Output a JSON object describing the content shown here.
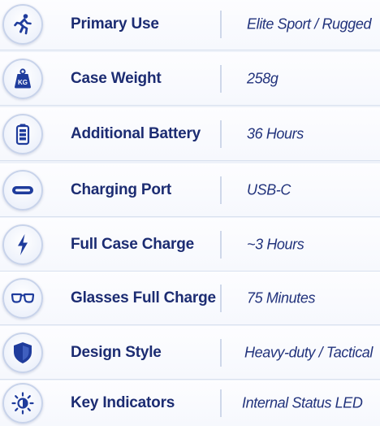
{
  "colors": {
    "accent": "#1c2c72",
    "value_text": "#22337c",
    "icon_blue": "#1f3c9c",
    "row_border": "#d9e1ef",
    "background": "#eef2f9"
  },
  "specs": [
    {
      "icon": "runner-icon",
      "label": "Primary Use",
      "value": "Elite Sport / Rugged"
    },
    {
      "icon": "weight-icon",
      "icon_text": "KG",
      "label": "Case Weight",
      "value": "258g"
    },
    {
      "icon": "battery-icon",
      "label": "Additional Battery",
      "value": "36 Hours"
    },
    {
      "icon": "usb-c-port-icon",
      "label": "Charging Port",
      "value": "USB-C"
    },
    {
      "icon": "lightning-bolt-icon",
      "label": "Full Case Charge",
      "value": "~3 Hours"
    },
    {
      "icon": "glasses-icon",
      "label": "Glasses Full Charge",
      "value": "75 Minutes"
    },
    {
      "icon": "shield-icon",
      "label": "Design Style",
      "value": "Heavy-duty / Tactical"
    },
    {
      "icon": "status-light-icon",
      "label": "Key Indicators",
      "value": "Internal Status LED"
    }
  ]
}
